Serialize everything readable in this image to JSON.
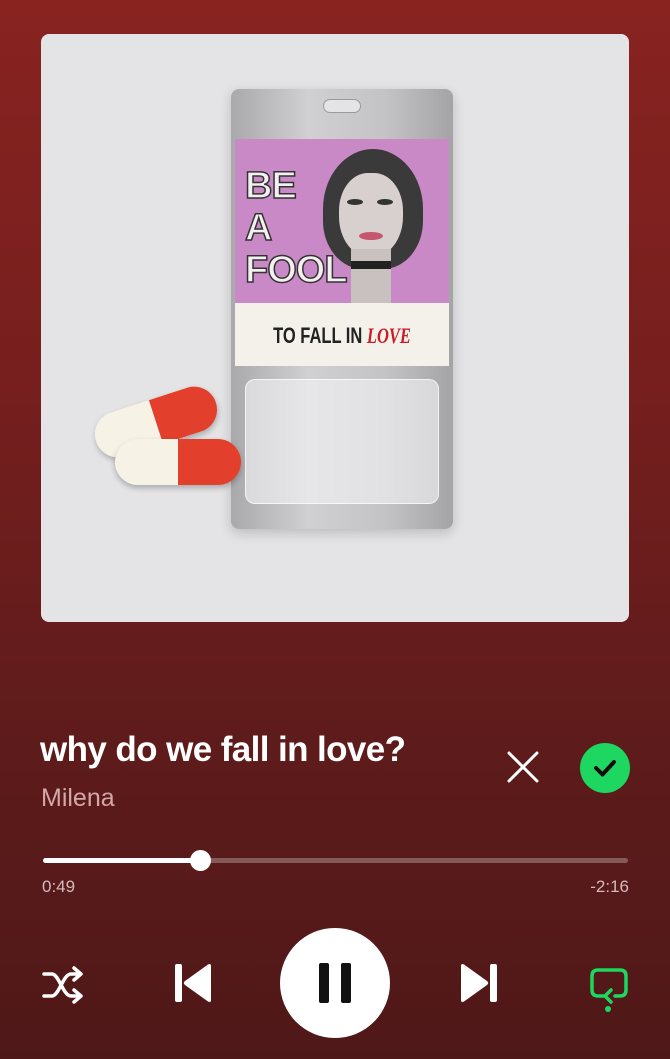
{
  "track": {
    "title": "why do we fall in love?",
    "artist": "Milena"
  },
  "artwork": {
    "words": [
      "BE",
      "A",
      "FOOL"
    ],
    "tagline_prefix": "TO FALL IN ",
    "tagline_love": "LOVE"
  },
  "playback": {
    "elapsed": "0:49",
    "remaining": "-2:16",
    "progress_fraction": 0.268,
    "state": "playing",
    "repeat": "on",
    "shuffle": "off"
  },
  "icons": {
    "remove": "close-icon",
    "saved": "check-icon",
    "shuffle": "shuffle-icon",
    "previous": "skip-previous-icon",
    "pause": "pause-icon",
    "next": "skip-next-icon",
    "repeat": "repeat-icon"
  },
  "colors": {
    "accent_green": "#1ed760",
    "background_top": "#882320",
    "background_bottom": "#4f1818"
  }
}
